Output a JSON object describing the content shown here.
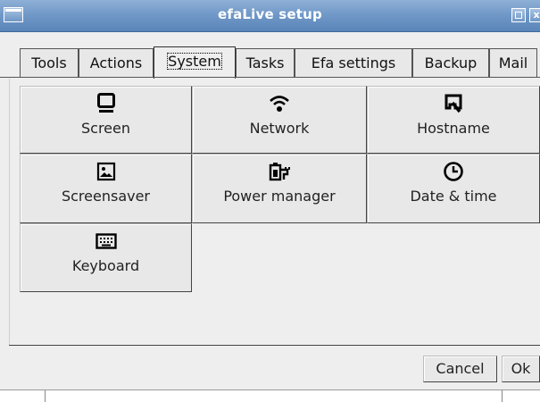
{
  "window": {
    "title": "efaLive setup",
    "titlebar_color": "#6f97c6"
  },
  "tabs": [
    {
      "label": "Tools",
      "active": false
    },
    {
      "label": "Actions",
      "active": false
    },
    {
      "label": "System",
      "active": true
    },
    {
      "label": "Tasks",
      "active": false
    },
    {
      "label": "Efa settings",
      "active": false
    },
    {
      "label": "Backup",
      "active": false
    },
    {
      "label": "Mail",
      "active": false
    }
  ],
  "system_buttons": [
    {
      "label": "Screen",
      "icon": "monitor-icon"
    },
    {
      "label": "Network",
      "icon": "wifi-icon"
    },
    {
      "label": "Hostname",
      "icon": "hostname-icon"
    },
    {
      "label": "Screensaver",
      "icon": "picture-icon"
    },
    {
      "label": "Power manager",
      "icon": "power-plug-icon"
    },
    {
      "label": "Date & time",
      "icon": "clock-icon"
    },
    {
      "label": "Keyboard",
      "icon": "keyboard-icon"
    }
  ],
  "dialog": {
    "cancel_label": "Cancel",
    "ok_label": "Ok"
  }
}
